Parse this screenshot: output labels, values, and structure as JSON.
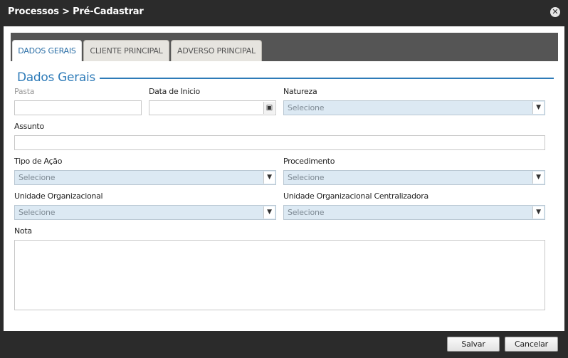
{
  "window": {
    "title": "Processos > Pré-Cadastrar"
  },
  "tabs": [
    {
      "label": "DADOS GERAIS"
    },
    {
      "label": "CLIENTE PRINCIPAL"
    },
    {
      "label": "ADVERSO PRINCIPAL"
    }
  ],
  "section": {
    "title": "Dados Gerais"
  },
  "form": {
    "pasta": {
      "label": "Pasta",
      "value": ""
    },
    "data_inicio": {
      "label": "Data de Inicio",
      "value": ""
    },
    "natureza": {
      "label": "Natureza",
      "value": "Selecione"
    },
    "assunto": {
      "label": "Assunto",
      "value": ""
    },
    "tipo_acao": {
      "label": "Tipo de Ação",
      "value": "Selecione"
    },
    "procedimento": {
      "label": "Procedimento",
      "value": "Selecione"
    },
    "unidade_org": {
      "label": "Unidade Organizacional",
      "value": "Selecione"
    },
    "unidade_org_central": {
      "label": "Unidade Organizacional Centralizadora",
      "value": "Selecione"
    },
    "nota": {
      "label": "Nota",
      "value": ""
    }
  },
  "footer": {
    "save_label": "Salvar",
    "cancel_label": "Cancelar"
  },
  "icons": {
    "close": "close-icon",
    "calendar": "calendar-icon",
    "dropdown": "chevron-down-icon"
  }
}
